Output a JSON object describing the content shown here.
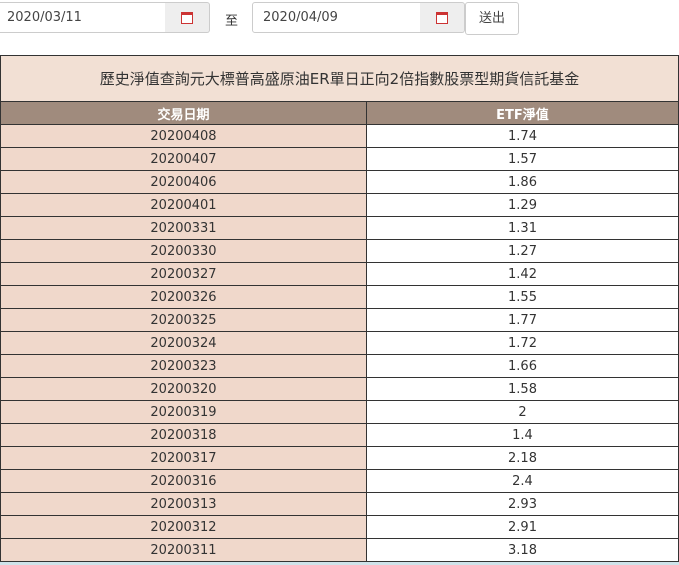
{
  "filter": {
    "start_date": "2020/03/11",
    "separator": "至",
    "end_date": "2020/04/09",
    "submit_label": "送出"
  },
  "table": {
    "title": "歷史淨值查詢元大標普高盛原油ER單日正向2倍指數股票型期貨信託基金",
    "headers": [
      "交易日期",
      "ETF淨值"
    ],
    "rows": [
      [
        "20200408",
        "1.74"
      ],
      [
        "20200407",
        "1.57"
      ],
      [
        "20200406",
        "1.86"
      ],
      [
        "20200401",
        "1.29"
      ],
      [
        "20200331",
        "1.31"
      ],
      [
        "20200330",
        "1.27"
      ],
      [
        "20200327",
        "1.42"
      ],
      [
        "20200326",
        "1.55"
      ],
      [
        "20200325",
        "1.77"
      ],
      [
        "20200324",
        "1.72"
      ],
      [
        "20200323",
        "1.66"
      ],
      [
        "20200320",
        "1.58"
      ],
      [
        "20200319",
        "2"
      ],
      [
        "20200318",
        "1.4"
      ],
      [
        "20200317",
        "2.18"
      ],
      [
        "20200316",
        "2.4"
      ],
      [
        "20200313",
        "2.93"
      ],
      [
        "20200312",
        "2.91"
      ],
      [
        "20200311",
        "3.18"
      ]
    ]
  }
}
